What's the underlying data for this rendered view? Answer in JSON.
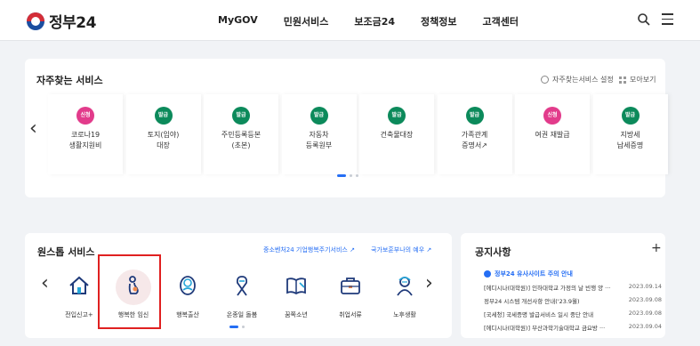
{
  "header": {
    "logo_text": "정부24",
    "nav": [
      "MyGOV",
      "민원서비스",
      "보조금24",
      "정책정보",
      "고객센터"
    ]
  },
  "frequent": {
    "title": "자주찾는 서비스",
    "settings_label": "자주찾는서비스 설정",
    "view_all_label": "모아보기",
    "items": [
      {
        "badge": "신청",
        "badge_color": "#e23b8b",
        "name": "코로나19\n생활지원비"
      },
      {
        "badge": "발급",
        "badge_color": "#0c8a5b",
        "name": "토지(임야)\n대장"
      },
      {
        "badge": "발급",
        "badge_color": "#0c8a5b",
        "name": "주민등록등본\n(초본)"
      },
      {
        "badge": "발급",
        "badge_color": "#0c8a5b",
        "name": "자동차\n등록원부"
      },
      {
        "badge": "발급",
        "badge_color": "#0c8a5b",
        "name": "건축물대장"
      },
      {
        "badge": "발급",
        "badge_color": "#0c8a5b",
        "name": "가족관계\n증명서↗"
      },
      {
        "badge": "신청",
        "badge_color": "#e23b8b",
        "name": "여권 재발급"
      },
      {
        "badge": "발급",
        "badge_color": "#0c8a5b",
        "name": "지방세\n납세증명"
      }
    ]
  },
  "onestop": {
    "title": "원스톱 서비스",
    "link1": "중소벤처24 기업행복주기서비스 ↗",
    "link2": "국가보훈부나의 예우 ↗",
    "items": [
      {
        "name": "전입신고+",
        "icon": "house-icon"
      },
      {
        "name": "행복한 임신",
        "icon": "pregnant-icon"
      },
      {
        "name": "행복출산",
        "icon": "baby-icon"
      },
      {
        "name": "온종일 돌봄",
        "icon": "ribbon-icon"
      },
      {
        "name": "꿈쪽소년",
        "icon": "book-icon"
      },
      {
        "name": "취업서류",
        "icon": "briefcase-icon"
      },
      {
        "name": "노후생활",
        "icon": "elder-icon"
      }
    ]
  },
  "notice": {
    "title": "공지사항",
    "pinned": "정부24 유사사이트 주의 안내",
    "rows": [
      {
        "title": "[에디시나(대학원)] 인하대학교 가정의 날 빈행 양 ···",
        "date": "2023.09.14"
      },
      {
        "title": "정부24 시스템 개선사항 안내('23.9월)",
        "date": "2023.09.08"
      },
      {
        "title": "[국세청] 국세증명 발급서비스 일시 중단 안내",
        "date": "2023.09.08"
      },
      {
        "title": "[에디시나(대학원)] 부산과학기술대학교 금요방 ···",
        "date": "2023.09.04"
      }
    ]
  },
  "colors": {
    "accent": "#256ef4",
    "highlight": "#e02020"
  }
}
